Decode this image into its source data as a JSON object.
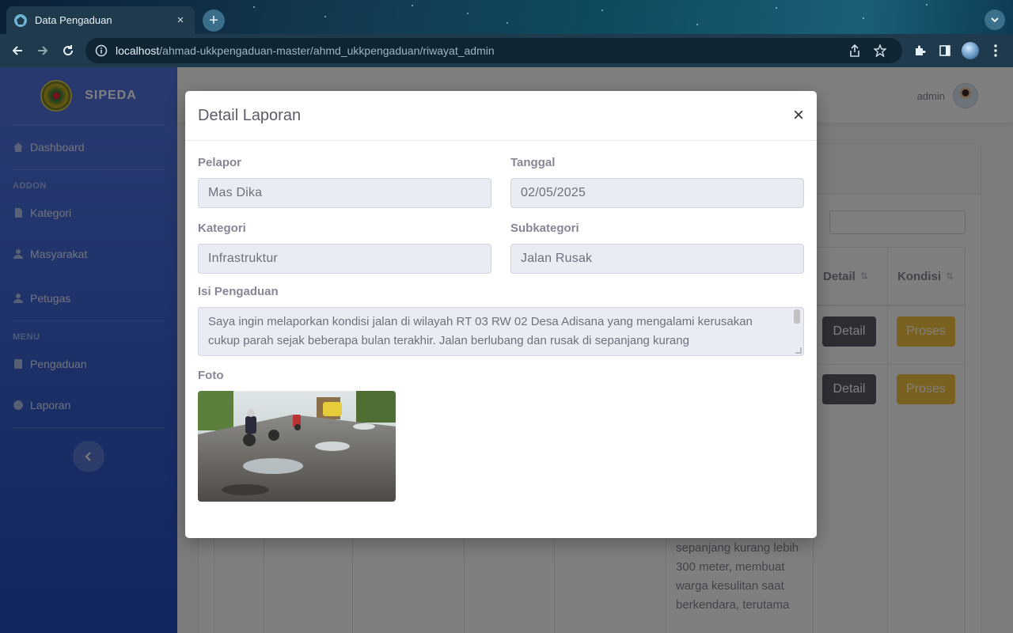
{
  "browser": {
    "tab_title": "Data Pengaduan",
    "tab_close": "×",
    "new_tab": "+",
    "url_host": "localhost",
    "url_path": "/ahmad-ukkpengaduan-master/ahmd_ukkpengaduan/riwayat_admin"
  },
  "sidebar": {
    "brand": "SIPEDA",
    "dashboard": "Dashboard",
    "heading_addon": "ADDON",
    "kategori": "Kategori",
    "masyarakat": "Masyarakat",
    "petugas": "Petugas",
    "heading_menu": "MENU",
    "pengaduan": "Pengaduan",
    "laporan": "Laporan"
  },
  "topbar": {
    "user_name": "admin"
  },
  "background_table": {
    "search_label": "n:",
    "col_detail": "Detail",
    "col_kondisi": "Kondisi",
    "sort_glyph": "⇅",
    "rows": [
      {
        "detail": "Detail",
        "status": "Proses"
      },
      {
        "detail": "Detail",
        "status": "Proses"
      }
    ],
    "cell_text": "berlubang dan rusak di sepanjang kurang lebih 300 meter, membuat warga kesulitan saat berkendara, terutama"
  },
  "modal": {
    "title": "Detail Laporan",
    "close": "×",
    "pelapor_label": "Pelapor",
    "pelapor_value": "Mas Dika",
    "tanggal_label": "Tanggal",
    "tanggal_value": "02/05/2025",
    "kategori_label": "Kategori",
    "kategori_value": "Infrastruktur",
    "subkategori_label": "Subkategori",
    "subkategori_value": "Jalan Rusak",
    "isi_label": "Isi Pengaduan",
    "isi_value": "Saya ingin melaporkan kondisi jalan di wilayah RT 03 RW 02 Desa Adisana yang mengalami kerusakan cukup parah sejak beberapa bulan terakhir. Jalan berlubang dan rusak di sepanjang kurang",
    "foto_label": "Foto"
  },
  "colors": {
    "sidebar_top": "#4e73df",
    "sidebar_bottom": "#224abe",
    "btn_detail": "#5a5c69",
    "btn_proses": "#f6c23e"
  }
}
